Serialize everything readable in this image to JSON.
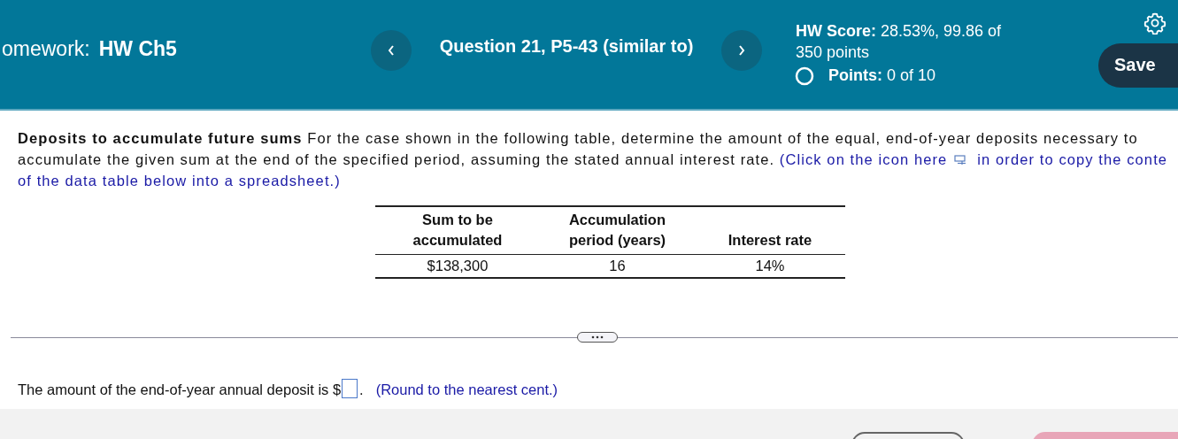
{
  "header": {
    "homework_label": "omework:",
    "homework_name": "HW Ch5",
    "question_title": "Question 21, P5-43 (similar to)",
    "score": "**HW Score:** 28.53%, 99.86 of 350 points",
    "points": "**Points:** 0 of 10",
    "points_complete": false,
    "save": "Save"
  },
  "problem": [
    {
      "kind": "bold",
      "text": "Deposits to accumulate future sums"
    },
    {
      "kind": "plain",
      "text": "For the case shown in the following table, determine the amount of the equal,  end-of-year deposits necessary to"
    },
    {
      "kind": "break"
    },
    {
      "kind": "plain",
      "text": "accumulate the given sum at the end of the specified period, assuming the stated annual interest rate. "
    },
    {
      "kind": "link",
      "text": "(Click on the icon here"
    },
    {
      "kind": "icon"
    },
    {
      "kind": "link",
      "text": "in order to copy the conte"
    },
    {
      "kind": "break"
    },
    {
      "kind": "link",
      "text": "of the data table below into a spreadsheet.)"
    }
  ],
  "table": {
    "columns": [
      "Sum to be accumulated",
      "Accumulation period (years)",
      "Interest rate"
    ],
    "rows": [
      [
        "$138,300",
        "16",
        "14%"
      ]
    ]
  },
  "answer": {
    "text": "The amount of the end-of-year annual deposit is $",
    "after": ".",
    "hint": "(Round to the nearest cent.)"
  }
}
